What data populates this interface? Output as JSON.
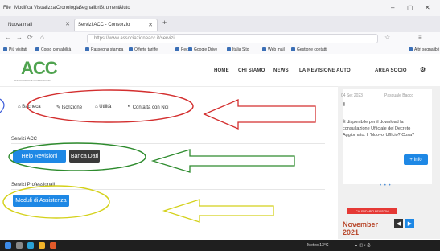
{
  "menubar": {
    "items": [
      "File",
      "Modifica",
      "Visualizza",
      "Cronologia",
      "Segnalibri",
      "Strumenti",
      "Aiuto"
    ],
    "minimize": "–",
    "maximize": "▢",
    "close": "✕"
  },
  "tabs": [
    {
      "label": "Nuova mail",
      "active": false
    },
    {
      "label": "Servizi ACC - Consorzio",
      "active": true
    }
  ],
  "nav": {
    "back": "←",
    "forward": "→",
    "reload": "⟳",
    "home": "⌂",
    "url": "https://www.associazioneacc.it/servizi"
  },
  "bookmarks": [
    "Più visitati",
    "Corso contabilità",
    "Rassegna stampa",
    "Offerte tariffe",
    "Pec",
    "Google Drive",
    "Italia Sito",
    "Web mail",
    "Gestione contatti",
    "Altri segnalibri"
  ],
  "header": {
    "logo_text": "ACC",
    "logo_tagline": "ASSOCIAZIONE CONSUMATORI",
    "nav": [
      "HOME",
      "CHI SIAMO",
      "NEWS",
      "LA REVISIONE AUTO",
      "AREA SOCIO"
    ]
  },
  "categories": [
    "Bacheca",
    "Iscrizione",
    "Utilità",
    "Contatta con Noi"
  ],
  "sections": [
    {
      "title": "Servizi ACC",
      "buttons": [
        "Help Revisioni",
        "Banca Dati"
      ]
    },
    {
      "title": "Servizi Professionali",
      "buttons": [
        "Moduli di Assistenza"
      ]
    }
  ],
  "sidebar": {
    "date": "04 Set 2023",
    "author": "Pasquale Bacco",
    "description": "È disponibile per il download la consultazione Ufficiale del Decreto Aggiornato: Il 'Nuovo' Ufficio? Cosa?",
    "button": "+ Info",
    "dots": "• • •",
    "badge": "CALENDARIO REVISIONI",
    "month": "November",
    "year": "2021",
    "prev": "◀",
    "next": "▶"
  },
  "taskbar": {
    "apps": [
      "Start",
      "Cerca",
      "Edge",
      "Esplora",
      "Mail"
    ],
    "status": "Meteo 13°C"
  },
  "annotations": {
    "colors": {
      "red": "#d32f2f",
      "green": "#2e8b2e",
      "yellow": "#d4d11a",
      "blue": "#1e88e5"
    }
  }
}
